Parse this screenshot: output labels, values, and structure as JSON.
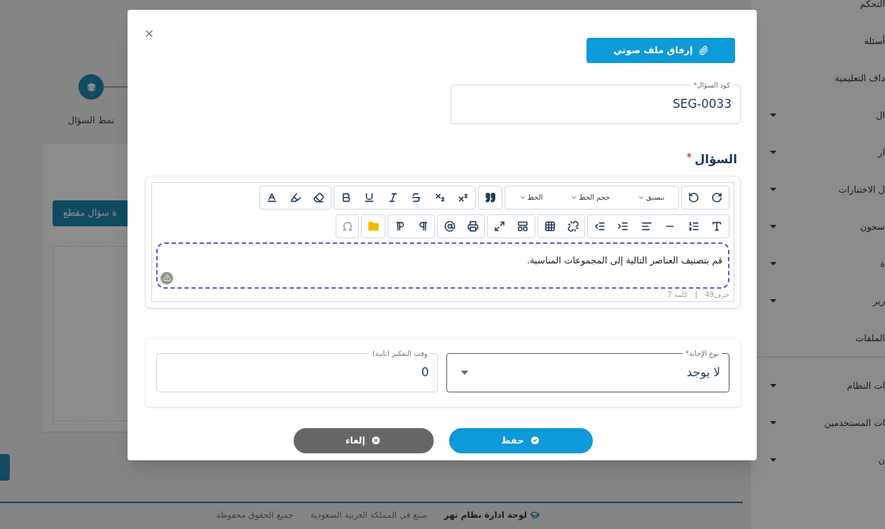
{
  "sidebar": {
    "groups": [
      [
        {
          "label": "التحكم",
          "expandable": false
        },
        {
          "label": "أسئلة",
          "expandable": false
        },
        {
          "label": "داف التعليمية",
          "expandable": false
        },
        {
          "label": "ال",
          "expandable": true
        },
        {
          "label": "ار",
          "expandable": true
        },
        {
          "label": "ل الاختبارات",
          "expandable": true
        },
        {
          "label": "سحون",
          "expandable": true
        },
        {
          "label": "ة",
          "expandable": true
        },
        {
          "label": "رير",
          "expandable": true
        },
        {
          "label": "الملفات",
          "expandable": false
        }
      ],
      [
        {
          "label": "ات النظام",
          "expandable": true
        },
        {
          "label": "ات المستخدمين",
          "expandable": true
        },
        {
          "label": "ن",
          "expandable": true
        }
      ]
    ]
  },
  "page": {
    "stepper": {
      "label": "نمط السؤال"
    },
    "card": {
      "button": "ة سؤال مقطع"
    }
  },
  "footer": {
    "items": [
      "لوحة ادارة نظام نهر",
      "صنع في المملكة العربية السعودية",
      "جميع الحقوق محفوظة"
    ]
  },
  "modal": {
    "attach_button": "إرفاق ملف صوتي",
    "code_field": {
      "label": "كود السؤال*",
      "value": "SEG-0033"
    },
    "question": {
      "label": "السؤال",
      "required": true,
      "toolbar_dropdowns": [
        "تنسيق",
        "حجم الخط",
        "الخط"
      ],
      "content": "قم بتصنيف العناصر التالية إلى المجموعات المناسبة.",
      "stats": [
        "حرف49",
        "كلمة 7"
      ]
    },
    "answer_type": {
      "label": "نوع الإجابة*",
      "value": "لا يوجد"
    },
    "thinking_time": {
      "label": "وقت التفكير (ثانية)",
      "value": "0"
    },
    "buttons": [
      {
        "label": "حفظ",
        "kind": "save"
      },
      {
        "label": "إلغاء",
        "kind": "cancel"
      }
    ]
  }
}
